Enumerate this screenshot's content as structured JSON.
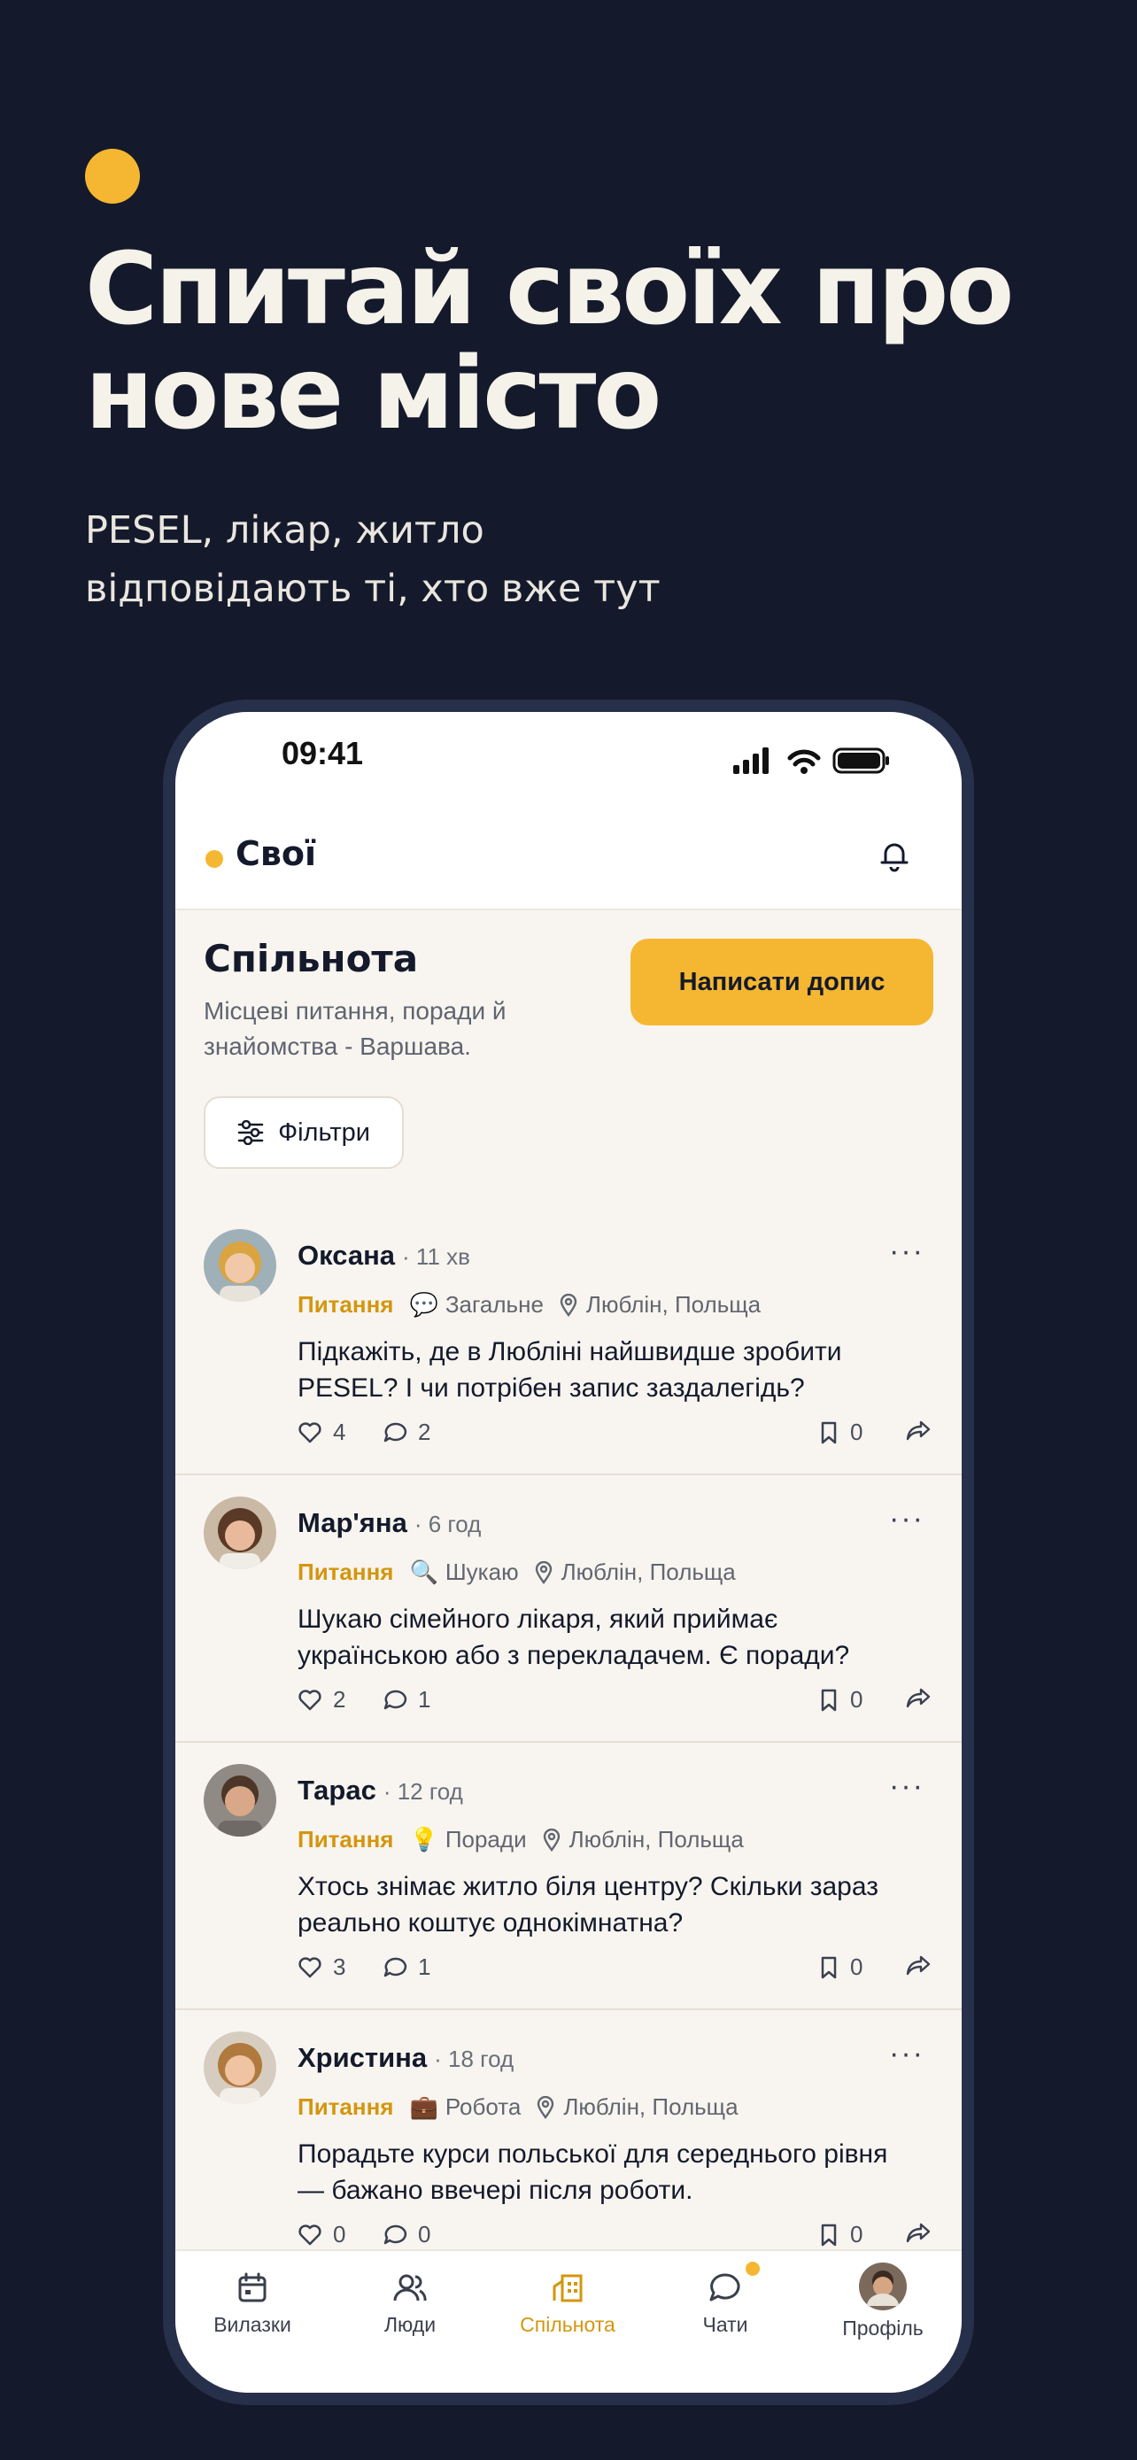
{
  "hero": {
    "title_line1": "Спитай своїх про",
    "title_line2": "нове місто",
    "subtitle_line1": "PESEL, лікар, житло",
    "subtitle_line2": "відповідають ті, хто вже тут"
  },
  "status_bar": {
    "time": "09:41"
  },
  "header": {
    "app_name": "Свої",
    "bell_icon": "bell-icon"
  },
  "community": {
    "title": "Спільнота",
    "description": "Місцеві питання, поради й знайомства - Варшава.",
    "write_button": "Написати допис",
    "filter_button": "Фільтри"
  },
  "posts": [
    {
      "author": "Оксана",
      "ago": "· 11 хв",
      "category": "Питання",
      "emoji": "💬",
      "type": "Загальне",
      "location": "Люблін, Польща",
      "text": "Підкажіть, де в Любліні найшвидше зробити PESEL? І чи потрібен запис заздалегідь?",
      "likes": "4",
      "comments": "2",
      "saves": "0"
    },
    {
      "author": "Мар'яна",
      "ago": "· 6 год",
      "category": "Питання",
      "emoji": "🔍",
      "type": "Шукаю",
      "location": "Люблін, Польща",
      "text": "Шукаю сімейного лікаря, який приймає українською або з перекладачем. Є поради?",
      "likes": "2",
      "comments": "1",
      "saves": "0"
    },
    {
      "author": "Тарас",
      "ago": "· 12 год",
      "category": "Питання",
      "emoji": "💡",
      "type": "Поради",
      "location": "Люблін, Польща",
      "text": "Хтось знімає житло біля центру? Скільки зараз реально коштує однокімнатна?",
      "likes": "3",
      "comments": "1",
      "saves": "0"
    },
    {
      "author": "Христина",
      "ago": "· 18 год",
      "category": "Питання",
      "emoji": "💼",
      "type": "Робота",
      "location": "Люблін, Польща",
      "text": "Порадьте курси польської для середнього рівня — бажано ввечері після роботи.",
      "likes": "0",
      "comments": "0",
      "saves": "0"
    }
  ],
  "tabbar": {
    "items": [
      {
        "label": "Вилазки",
        "icon": "calendar-icon"
      },
      {
        "label": "Люди",
        "icon": "people-icon"
      },
      {
        "label": "Спільнота",
        "icon": "community-icon",
        "active": true
      },
      {
        "label": "Чати",
        "icon": "chat-icon"
      },
      {
        "label": "Профіль",
        "icon": "profile-avatar"
      }
    ]
  },
  "colors": {
    "accent": "#f5b731",
    "background": "#141a2b",
    "card": "#f8f5f0",
    "category": "#d4960e"
  }
}
